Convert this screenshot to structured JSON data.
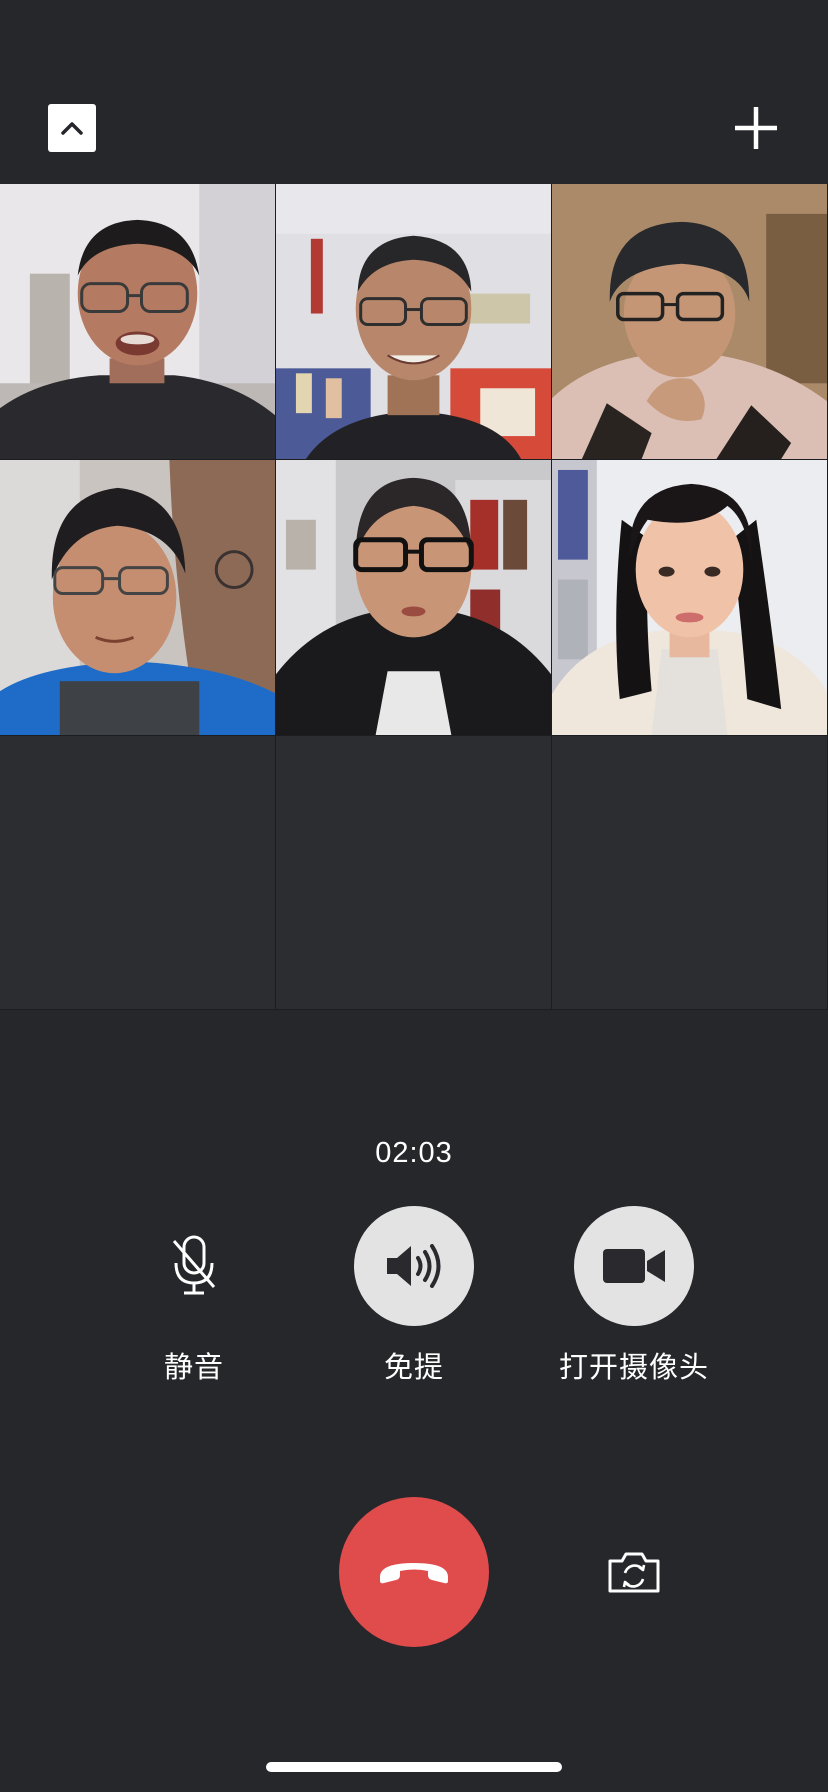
{
  "call": {
    "duration": "02:03"
  },
  "header": {
    "collapse_icon": "chevron-up-icon",
    "add_icon": "plus-icon"
  },
  "grid": {
    "tiles": [
      {
        "state": "video"
      },
      {
        "state": "video"
      },
      {
        "state": "video"
      },
      {
        "state": "video"
      },
      {
        "state": "video"
      },
      {
        "state": "video"
      },
      {
        "state": "empty"
      },
      {
        "state": "empty"
      },
      {
        "state": "empty"
      }
    ]
  },
  "controls": {
    "mute": {
      "label": "静音",
      "icon": "microphone-off-icon"
    },
    "speaker": {
      "label": "免提",
      "icon": "speaker-icon",
      "active": true
    },
    "camera": {
      "label": "打开摄像头",
      "icon": "video-camera-icon",
      "active": true
    }
  },
  "bottom": {
    "hangup_icon": "phone-hangup-icon",
    "hangup_color": "#e04c4c",
    "flip_icon": "camera-flip-icon"
  },
  "colors": {
    "background": "#26272b",
    "control_fill": "#e3e3e3"
  }
}
